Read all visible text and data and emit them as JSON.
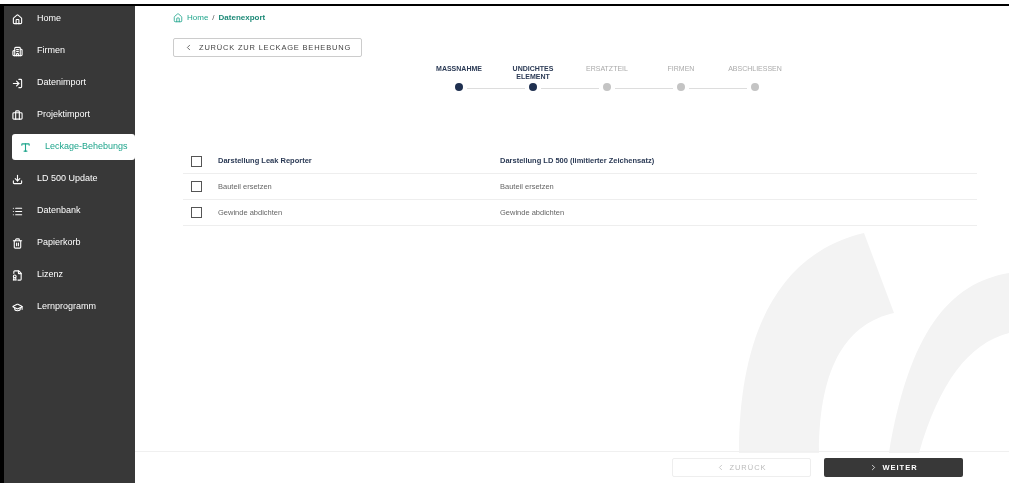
{
  "sidebar": {
    "items": [
      {
        "label": "Home",
        "selected": false
      },
      {
        "label": "Firmen",
        "selected": false
      },
      {
        "label": "Datenimport",
        "selected": false
      },
      {
        "label": "Projektimport",
        "selected": false
      },
      {
        "label": "Leckage-Behebungs",
        "selected": true
      },
      {
        "label": "LD 500 Update",
        "selected": false
      },
      {
        "label": "Datenbank",
        "selected": false
      },
      {
        "label": "Papierkorb",
        "selected": false
      },
      {
        "label": "Lizenz",
        "selected": false
      },
      {
        "label": "Lernprogramm",
        "selected": false
      }
    ]
  },
  "breadcrumb": {
    "home": "Home",
    "separator": "/",
    "current": "Datenexport"
  },
  "back_button": "ZURÜCK ZUR LECKAGE BEHEBUNG",
  "stepper": [
    {
      "label": "MASSNAHME",
      "completed": true
    },
    {
      "label": "UNDICHTES ELEMENT",
      "completed": true
    },
    {
      "label": "ERSATZTEIL",
      "completed": false
    },
    {
      "label": "FIRMEN",
      "completed": false
    },
    {
      "label": "ABSCHLIESSEN",
      "completed": false
    }
  ],
  "table": {
    "header": {
      "checked": false,
      "columns": [
        "Darstellung Leak Reporter",
        "Darstellung LD 500 (limitierter Zeichensatz)"
      ]
    },
    "rows": [
      {
        "checked": false,
        "cells": [
          "Bauteil ersetzen",
          "Bauteil ersetzen"
        ]
      },
      {
        "checked": false,
        "cells": [
          "Gewinde abdichten",
          "Gewinde abdichten"
        ]
      }
    ]
  },
  "footer": {
    "previous": {
      "label": "ZURÜCK",
      "disabled": true
    },
    "next": {
      "label": "WEITER",
      "disabled": false
    }
  }
}
